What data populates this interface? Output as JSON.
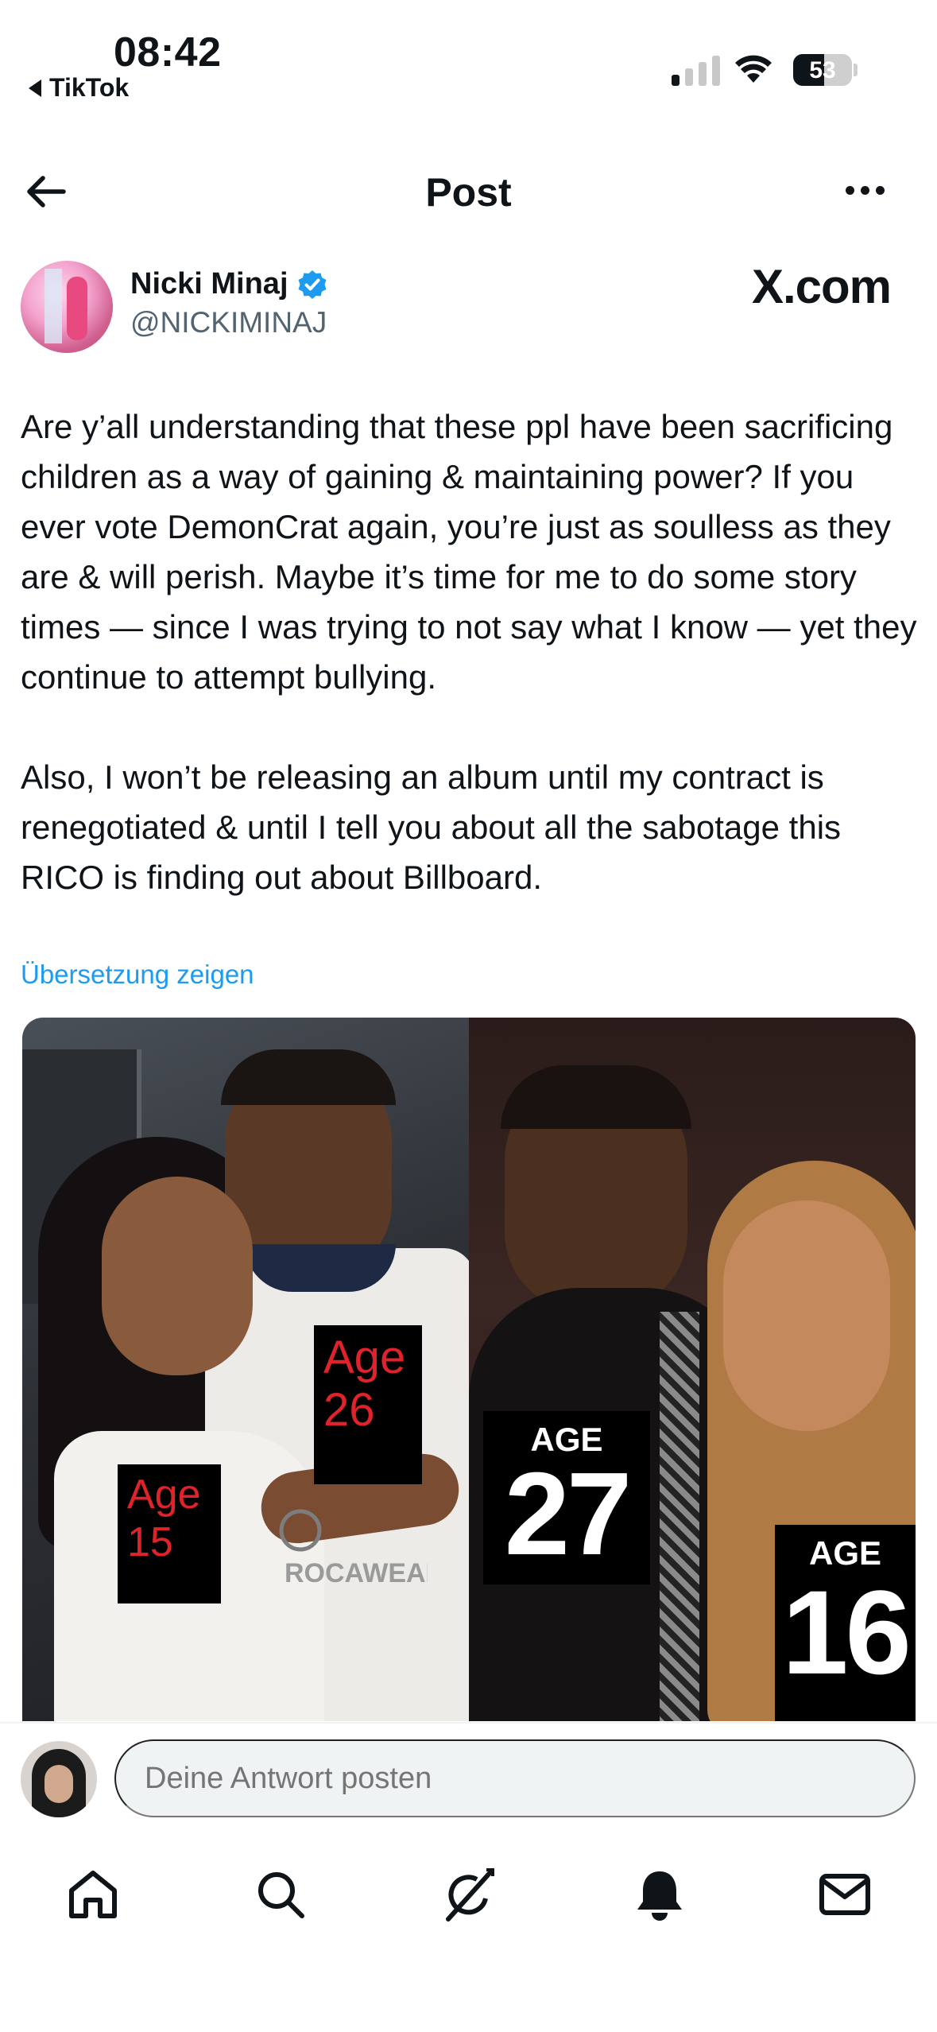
{
  "status_bar": {
    "time": "08:42",
    "back_app": "TikTok",
    "battery_level": "53",
    "battery_fraction": 0.53
  },
  "header": {
    "title": "Post"
  },
  "author": {
    "name": "Nicki Minaj",
    "handle": "@NICKIMINAJ",
    "verified": true,
    "site_label": "X.com"
  },
  "post": {
    "paragraphs": [
      "Are y’all understanding that these ppl have been sacrificing children as a way of gaining & maintaining power? If you ever vote DemonCrat again, you’re just as soulless as they are & will perish. Maybe it’s time for me to do some story times — since I was trying to not say what I know — yet they continue to attempt bullying.",
      "Also, I won’t be releasing an album until my contract is renegotiated & until I tell you about all the sabotage this RICO is finding out about Billboard."
    ],
    "translate_link": "Übersetzung zeigen"
  },
  "media": {
    "labels": {
      "left_man": {
        "word": "Age",
        "number": "26"
      },
      "left_woman": {
        "word": "Age",
        "number": "15"
      },
      "right_man": {
        "word": "AGE",
        "number": "27"
      },
      "right_woman": {
        "word": "AGE",
        "number": "16"
      }
    },
    "shirt_text": "ROCAWEAR"
  },
  "reply": {
    "placeholder": "Deine Antwort posten"
  },
  "bottom_nav": {
    "items": [
      "home-icon",
      "search-icon",
      "grok-icon",
      "notifications-icon",
      "messages-icon"
    ]
  },
  "colors": {
    "accent": "#1d9bf0",
    "text": "#0f1419",
    "muted": "#536471",
    "age_red": "#e0222a"
  }
}
